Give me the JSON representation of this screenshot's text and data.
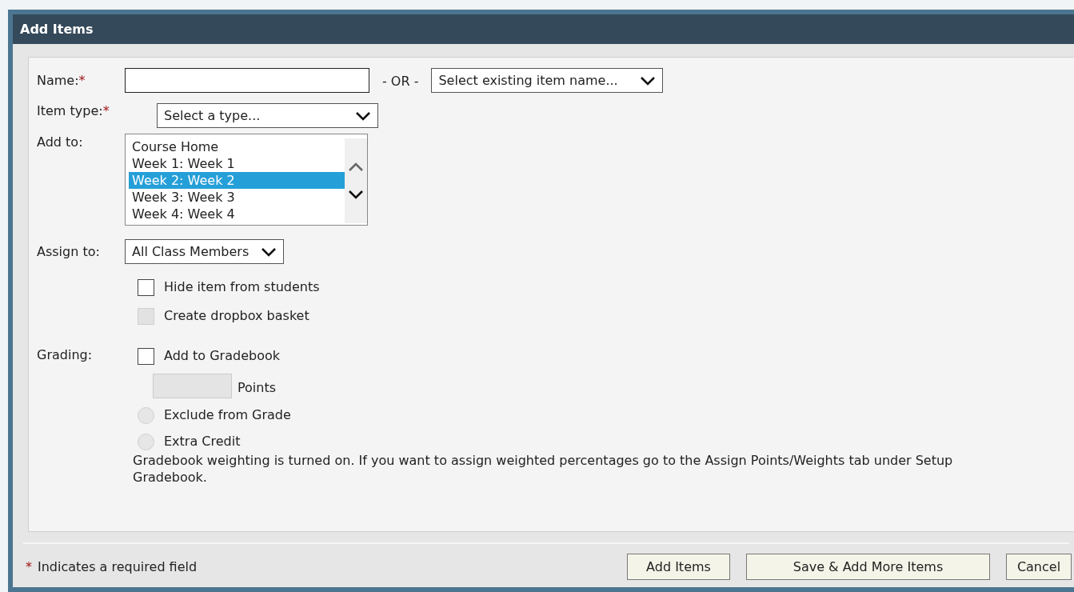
{
  "window": {
    "title": "Add Items"
  },
  "name_row": {
    "label": "Name:",
    "required": true,
    "separator": "- OR -",
    "existing_select": "Select existing item name..."
  },
  "type_row": {
    "label": "Item type:",
    "required": true,
    "select": "Select a type..."
  },
  "add_to": {
    "label": "Add to:",
    "options": [
      {
        "label": "Course Home",
        "selected": false
      },
      {
        "label": "Week 1: Week 1",
        "selected": false
      },
      {
        "label": "Week 2: Week 2",
        "selected": true
      },
      {
        "label": "Week 3: Week 3",
        "selected": false
      },
      {
        "label": "Week 4: Week 4",
        "selected": false
      }
    ]
  },
  "assign_to": {
    "label": "Assign to:",
    "select": "All Class Members"
  },
  "options": [
    {
      "label": "Hide item from students",
      "checked": false,
      "disabled": false
    },
    {
      "label": "Create dropbox basket",
      "checked": false,
      "disabled": true
    }
  ],
  "grading": {
    "label": "Grading:",
    "gradebook": {
      "label": "Add to Gradebook",
      "checked": false,
      "disabled": false
    },
    "points": {
      "label": "Points",
      "disabled": true
    },
    "radios": [
      {
        "label": "Exclude from Grade",
        "selected": false,
        "disabled": true
      },
      {
        "label": "Extra Credit",
        "selected": false,
        "disabled": true
      }
    ],
    "note": "Gradebook weighting is turned on. If you want to assign weighted percentages go to the Assign Points/Weights tab under Setup Gradebook."
  },
  "footer": {
    "required_mark": "*",
    "required_note": "Indicates a required field",
    "buttons": [
      "Add Items",
      "Save & Add More Items",
      "Cancel"
    ]
  }
}
